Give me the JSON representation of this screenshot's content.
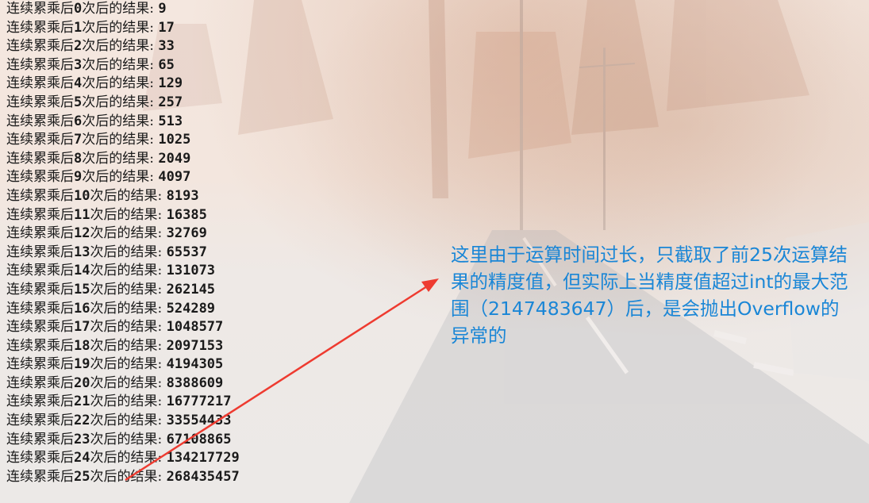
{
  "console": {
    "lines": [
      {
        "prefix": "连续累乘后",
        "n": "0",
        "suffix": "次后的结果: ",
        "value": "9"
      },
      {
        "prefix": "连续累乘后",
        "n": "1",
        "suffix": "次后的结果: ",
        "value": "17"
      },
      {
        "prefix": "连续累乘后",
        "n": "2",
        "suffix": "次后的结果: ",
        "value": "33"
      },
      {
        "prefix": "连续累乘后",
        "n": "3",
        "suffix": "次后的结果: ",
        "value": "65"
      },
      {
        "prefix": "连续累乘后",
        "n": "4",
        "suffix": "次后的结果: ",
        "value": "129"
      },
      {
        "prefix": "连续累乘后",
        "n": "5",
        "suffix": "次后的结果: ",
        "value": "257"
      },
      {
        "prefix": "连续累乘后",
        "n": "6",
        "suffix": "次后的结果: ",
        "value": "513"
      },
      {
        "prefix": "连续累乘后",
        "n": "7",
        "suffix": "次后的结果: ",
        "value": "1025"
      },
      {
        "prefix": "连续累乘后",
        "n": "8",
        "suffix": "次后的结果: ",
        "value": "2049"
      },
      {
        "prefix": "连续累乘后",
        "n": "9",
        "suffix": "次后的结果: ",
        "value": "4097"
      },
      {
        "prefix": "连续累乘后",
        "n": "10",
        "suffix": "次后的结果: ",
        "value": "8193"
      },
      {
        "prefix": "连续累乘后",
        "n": "11",
        "suffix": "次后的结果: ",
        "value": "16385"
      },
      {
        "prefix": "连续累乘后",
        "n": "12",
        "suffix": "次后的结果: ",
        "value": "32769"
      },
      {
        "prefix": "连续累乘后",
        "n": "13",
        "suffix": "次后的结果: ",
        "value": "65537"
      },
      {
        "prefix": "连续累乘后",
        "n": "14",
        "suffix": "次后的结果: ",
        "value": "131073"
      },
      {
        "prefix": "连续累乘后",
        "n": "15",
        "suffix": "次后的结果: ",
        "value": "262145"
      },
      {
        "prefix": "连续累乘后",
        "n": "16",
        "suffix": "次后的结果: ",
        "value": "524289"
      },
      {
        "prefix": "连续累乘后",
        "n": "17",
        "suffix": "次后的结果: ",
        "value": "1048577"
      },
      {
        "prefix": "连续累乘后",
        "n": "18",
        "suffix": "次后的结果: ",
        "value": "2097153"
      },
      {
        "prefix": "连续累乘后",
        "n": "19",
        "suffix": "次后的结果: ",
        "value": "4194305"
      },
      {
        "prefix": "连续累乘后",
        "n": "20",
        "suffix": "次后的结果: ",
        "value": "8388609"
      },
      {
        "prefix": "连续累乘后",
        "n": "21",
        "suffix": "次后的结果: ",
        "value": "16777217"
      },
      {
        "prefix": "连续累乘后",
        "n": "22",
        "suffix": "次后的结果: ",
        "value": "33554433"
      },
      {
        "prefix": "连续累乘后",
        "n": "23",
        "suffix": "次后的结果: ",
        "value": "67108865"
      },
      {
        "prefix": "连续累乘后",
        "n": "24",
        "suffix": "次后的结果: ",
        "value": "134217729"
      },
      {
        "prefix": "连续累乘后",
        "n": "25",
        "suffix": "次后的结果: ",
        "value": "268435457"
      }
    ]
  },
  "annotation": {
    "text": "这里由于运算时间过长，只截取了前25次运算结果的精度值，但实际上当精度值超过int的最大范围（2147483647）后，是会抛出Overflow的异常的",
    "color": "#1a86d6"
  },
  "arrow": {
    "color": "#ee3b30"
  },
  "theme": {
    "text_color": "#1a1a1a",
    "background": "faded desert road wallpaper"
  }
}
